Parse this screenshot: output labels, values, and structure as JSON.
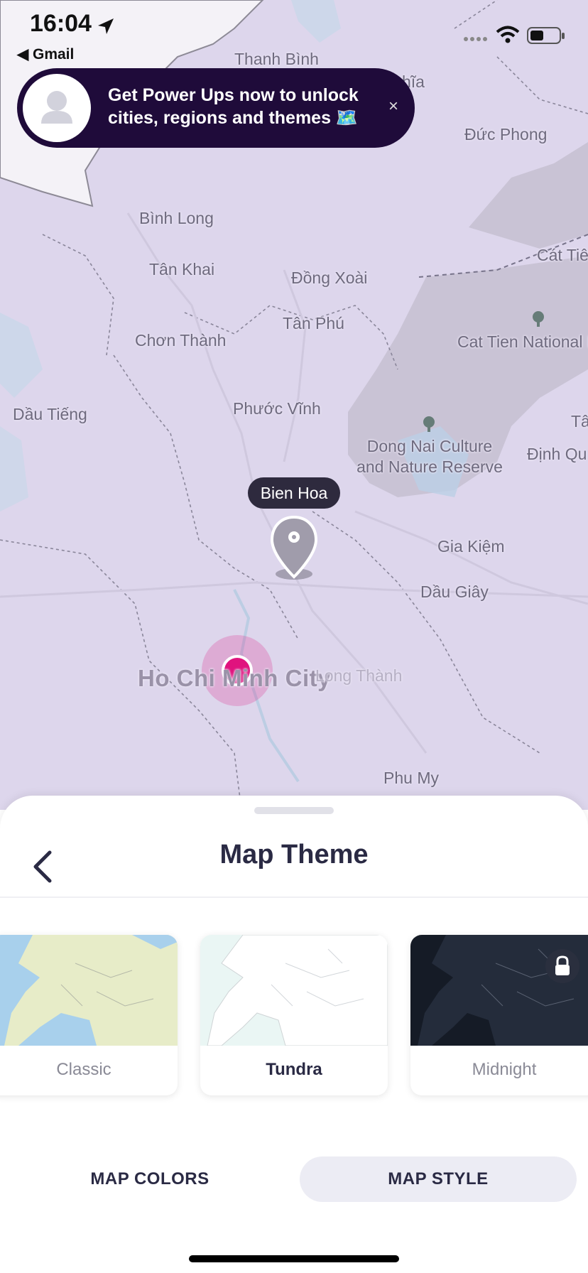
{
  "status_bar": {
    "time": "16:04",
    "back_app": "◀ Gmail"
  },
  "banner": {
    "message": "Get Power Ups now to unlock cities, regions and themes 🗺️",
    "close": "×"
  },
  "map": {
    "places": [
      "Thanh Bình",
      "hĩa",
      "Đức Phong",
      "Bình Long",
      "Tân Khai",
      "Đồng Xoài",
      "Cát Tiê",
      "Tân Phú",
      "Chơn Thành",
      "Cat Tien National P",
      "Dầu Tiếng",
      "Phước Vĩnh",
      "Tâ",
      "Dong Nai Culture and Nature Reserve",
      "Định Qu",
      "Gia Kiệm",
      "Dầu Giây",
      "Ho Chi Minh City",
      "Long Thành",
      "Phu My"
    ],
    "selected_marker": "Bien Hoa",
    "accent_color": "#e0137e"
  },
  "sheet": {
    "title": "Map Theme",
    "themes": [
      {
        "label": "Classic",
        "selected": false,
        "locked": false
      },
      {
        "label": "Tundra",
        "selected": true,
        "locked": false
      },
      {
        "label": "Midnight",
        "selected": false,
        "locked": true
      }
    ],
    "tabs": [
      {
        "label": "MAP COLORS",
        "active": false
      },
      {
        "label": "MAP STYLE",
        "active": true
      }
    ]
  }
}
